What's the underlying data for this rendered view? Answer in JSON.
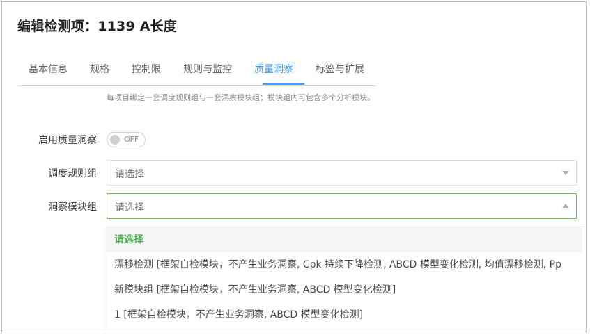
{
  "page": {
    "title": "编辑检测项：1139 A长度"
  },
  "tabs": [
    {
      "label": "基本信息",
      "active": false
    },
    {
      "label": "规格",
      "active": false
    },
    {
      "label": "控制限",
      "active": false
    },
    {
      "label": "规则与监控",
      "active": false
    },
    {
      "label": "质量洞察",
      "active": true
    },
    {
      "label": "标签与扩展",
      "active": false
    }
  ],
  "hint": "每项目绑定一套调度规则组与一套洞察模块组；模块组内可包含多个分析模块。",
  "form": {
    "enable_label": "启用质量洞察",
    "enable_switch_text": "OFF",
    "schedule_label": "调度规则组",
    "schedule_value": "请选择",
    "module_label": "洞察模块组",
    "module_value": "请选择"
  },
  "dropdown": {
    "options": [
      "请选择",
      "漂移检测 [框架自检模块，不产生业务洞察, Cpk 持续下降检测, ABCD 模型变化检测, 均值漂移检测, Pp",
      "新模块组 [框架自检模块，不产生业务洞察, ABCD 模型变化检测]",
      "1 [框架自检模块，不产生业务洞察, ABCD 模型变化检测]"
    ],
    "selected_index": 0
  },
  "colors": {
    "accent": "#409eff",
    "focus": "#67c23a",
    "selected_text": "#4caf50"
  }
}
